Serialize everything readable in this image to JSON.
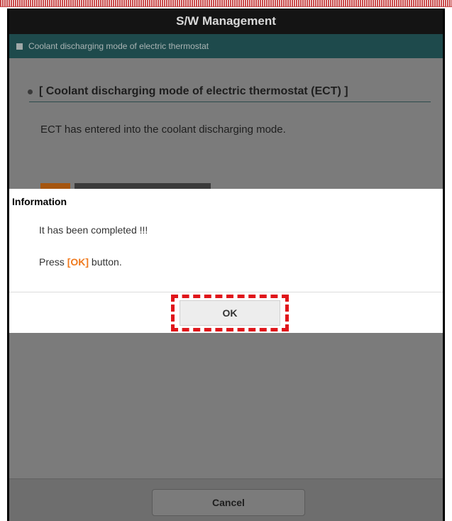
{
  "window": {
    "title": "S/W Management"
  },
  "subheader": {
    "label": "Coolant discharging mode of electric thermostat"
  },
  "content": {
    "section_title": "[ Coolant discharging mode of electric thermostat (ECT) ]",
    "message": "ECT has entered into the coolant discharging mode."
  },
  "dialog": {
    "title": "Information",
    "line1": "It has been completed !!!",
    "line2_prefix": "Press ",
    "line2_highlight": "[OK]",
    "line2_suffix": " button.",
    "ok_label": "OK"
  },
  "footer": {
    "cancel_label": "Cancel"
  },
  "colors": {
    "title_bar": "#141414",
    "subheader": "#1e4a4c",
    "overlay": "#7b7b7b",
    "highlight_orange": "#f07a1e",
    "annotation_red": "#e0151a"
  }
}
